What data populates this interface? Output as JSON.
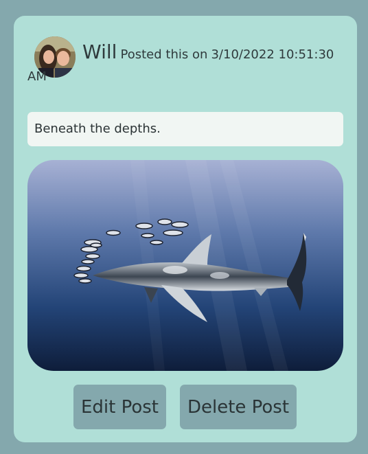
{
  "post": {
    "username": "Will",
    "posted_prefix": "Posted this on",
    "timestamp": "3/10/2022 10:51:30 AM",
    "text": "Beneath the depths.",
    "image_subject": "oceanic whitetip shark with pilot fish",
    "avatar_subject": "couple selfie"
  },
  "actions": {
    "edit_label": "Edit Post",
    "delete_label": "Delete Post"
  },
  "colors": {
    "page_background": "#84a8ad",
    "card_background": "#b0dfd7",
    "text_box_background": "#f1f6f3",
    "button_background": "#84a8ad"
  }
}
